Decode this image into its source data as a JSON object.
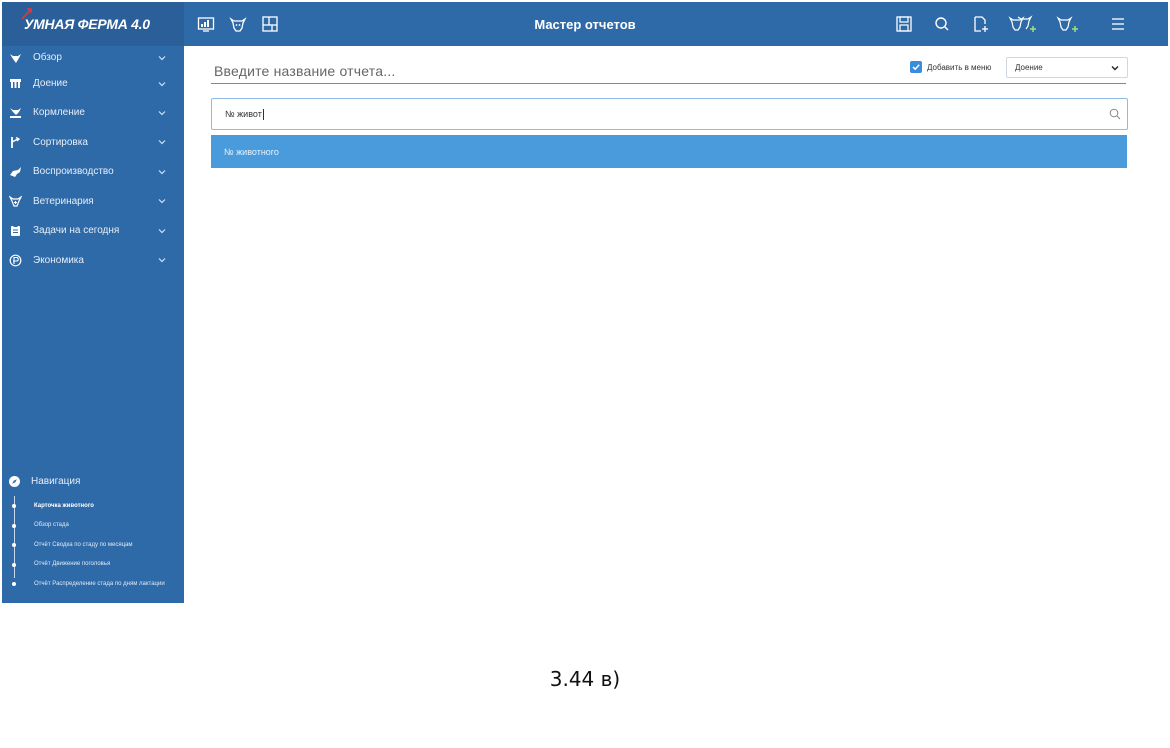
{
  "app": {
    "logo_text": "УМНАЯ ФЕРМА 4.0",
    "title": "Мастер отчетов"
  },
  "colors": {
    "primary": "#2f6aa8",
    "logo_bg": "#2a5f99",
    "accent": "#4a9bdb",
    "checkbox": "#3a8dde",
    "star": "#e53935"
  },
  "topbar": {
    "left_icons": [
      "dashboard-icon",
      "cow-icon",
      "floorplan-icon"
    ],
    "right_icons": [
      "save-icon",
      "search-icon",
      "add-file-icon",
      "cow-group-add-icon",
      "cow-add-icon",
      "hamburger-menu-icon"
    ]
  },
  "sidebar": {
    "items": [
      {
        "label": "Обзор",
        "icon": "overview-icon"
      },
      {
        "label": "Доение",
        "icon": "milking-icon"
      },
      {
        "label": "Кормление",
        "icon": "feeding-icon"
      },
      {
        "label": "Сортировка",
        "icon": "sorting-icon"
      },
      {
        "label": "Воспроизводство",
        "icon": "reproduction-icon"
      },
      {
        "label": "Ветеринария",
        "icon": "veterinary-icon"
      },
      {
        "label": "Задачи на сегодня",
        "icon": "tasks-icon"
      },
      {
        "label": "Экономика",
        "icon": "economy-icon"
      }
    ],
    "navigation": {
      "title": "Навигация",
      "links": [
        {
          "label": "Карточка животного",
          "active": true
        },
        {
          "label": "Обзор стада",
          "active": false
        },
        {
          "label": "Отчёт Сводка по стаду по месяцам",
          "active": false
        },
        {
          "label": "Отчёт Движение поголовья",
          "active": false
        },
        {
          "label": "Отчёт Распределение стада по дням лактации",
          "active": false
        }
      ]
    }
  },
  "main": {
    "report_name_placeholder": "Введите название отчета...",
    "add_to_menu_label": "Добавить в меню",
    "add_to_menu_checked": true,
    "menu_select_value": "Доение",
    "search_value": "№ живот",
    "suggestions": [
      "№ животного"
    ]
  },
  "caption": "3.44 в)"
}
